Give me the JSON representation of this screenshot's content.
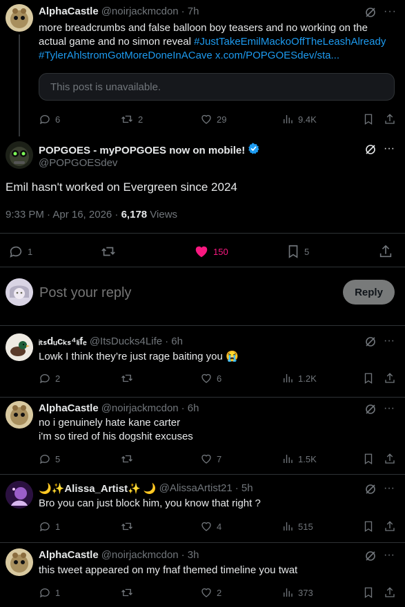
{
  "tweet1": {
    "name": "AlphaCastle",
    "handle": "@noirjackmcdon",
    "time": "· 7h",
    "text_plain": "more breadcrumbs and false balloon boy teasers and no working on the actual game and no simon reveal ",
    "hashtag1": "#JustTakeEmilMackoOffTheLeashAlready",
    "hashtag2": "#TylerAhlstromGotMoreDoneInACave",
    "link": "x.com/POPGOESdev/sta...",
    "quote_unavailable": "This post is unavailable.",
    "replies": "6",
    "reposts": "2",
    "likes": "29",
    "views": "9.4K"
  },
  "main": {
    "name": "POPGOES - myPOPGOES now on mobile!",
    "handle": "@POPGOESdev",
    "text": "Emil hasn't worked on Evergreen since 2024",
    "timestamp": "9:33 PM · Apr 16, 2026 · ",
    "views_count": "6,178",
    "views_label": " Views",
    "replies": "1",
    "likes": "150",
    "bookmarks": "5",
    "like_color": "#f91880"
  },
  "composer": {
    "placeholder": "Post your reply",
    "reply_button": "Reply"
  },
  "replies": [
    {
      "name": "ᵢₜₛdᵤcₖₛ⁴ₗᵢfₑ",
      "handle": "@ItsDucks4Life",
      "time": "· 6h",
      "text": "Lowk I think they’re just rage baiting you 😭",
      "replies": "2",
      "reposts": "",
      "likes": "6",
      "views": "1.2K"
    },
    {
      "name": "AlphaCastle",
      "handle": "@noirjackmcdon",
      "time": "· 6h",
      "text_line1": "no i genuinely hate kane carter",
      "text_line2": "i'm so tired of his dogshit excuses",
      "replies": "5",
      "reposts": "",
      "likes": "7",
      "views": "1.5K"
    },
    {
      "name": "🌙✨Alissa_Artist✨ 🌙",
      "handle": "@AlissaArtist21",
      "time": "· 5h",
      "text": "Bro you can just block him, you know that right ?",
      "replies": "1",
      "reposts": "",
      "likes": "4",
      "views": "515"
    },
    {
      "name": "AlphaCastle",
      "handle": "@noirjackmcdon",
      "time": "· 3h",
      "text": "this tweet appeared on my fnaf themed timeline you twat",
      "replies": "1",
      "reposts": "",
      "likes": "2",
      "views": "373"
    }
  ],
  "colors": {
    "background": "#000000",
    "link": "#1d9bf0",
    "muted": "#71767b",
    "divider": "#2f3336",
    "verified": "#1d9bf0"
  }
}
